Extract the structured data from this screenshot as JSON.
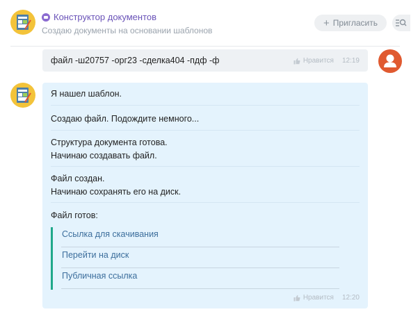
{
  "header": {
    "title": "Конструктор документов",
    "subtitle": "Создаю документы на основании шаблонов",
    "invite_label": "Пригласить"
  },
  "messages": [
    {
      "direction": "outgoing",
      "text": "файл -ш20757 -орг23 -сделка404 -пдф -ф",
      "like_label": "Нравится",
      "time": "12:19"
    },
    {
      "direction": "incoming",
      "lines": [
        "Я нашел шаблон.",
        "Создаю файл. Подождите немного...",
        "Структура документа готова.",
        "Начинаю создавать файл.",
        "Файл создан.",
        "Начинаю сохранять его на диск.",
        "Файл готов:"
      ],
      "links": [
        "Ссылка для скачивания",
        "Перейти на диск",
        "Публичная ссылка"
      ],
      "like_label": "Нравится",
      "time": "12:20"
    }
  ],
  "colors": {
    "accent_purple": "#6a53b8",
    "bot_bubble": "#e4f3fd",
    "user_bubble": "#eef1f4",
    "link": "#3c6e9c",
    "quote_bar": "#20a88a",
    "user_avatar": "#e05a30",
    "bot_avatar": "#f3c33a"
  },
  "icons": {
    "bot_avatar": "document-form-icon",
    "title_badge": "bot-icon",
    "invite": "plus-icon",
    "search": "search-list-icon",
    "like": "thumbs-up-icon",
    "user_avatar": "user-silhouette-icon"
  }
}
